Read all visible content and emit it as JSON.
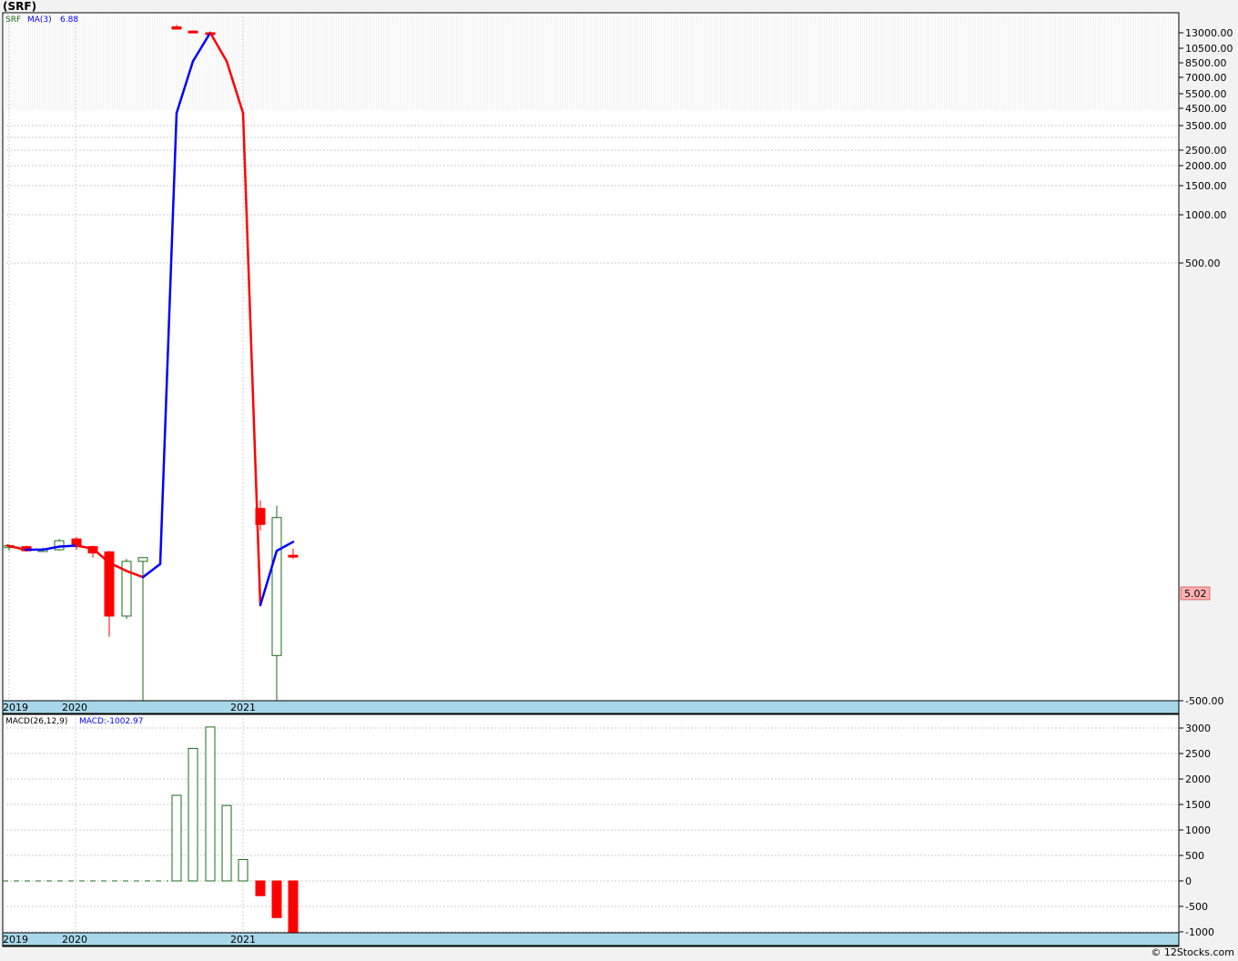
{
  "page_title": "(SRF)",
  "credit": "© 12Stocks.com",
  "colors": {
    "up": "#1a6e1a",
    "down": "#ff0000",
    "ma_up": "#0000ff",
    "ma_down": "#ff0000",
    "year_band": "#a8d8e8",
    "last_price_bg": "#ffb3b3"
  },
  "price_panel": {
    "symbol_label": "SRF",
    "ma_label": "MA(3)",
    "ma_value": "6.88",
    "last_price_label": "5.02",
    "y_ticks": [
      "13000.00",
      "10500.00",
      "8500.00",
      "7000.00",
      "5500.00",
      "4500.00",
      "3500.00",
      "2500.00",
      "2000.00",
      "1500.00",
      "1000.00",
      "500.00",
      "-500.00"
    ],
    "year_labels": [
      "2019",
      "2020",
      "2021"
    ]
  },
  "macd_panel": {
    "label": "MACD(26,12,9)",
    "value_label": "MACD:-1002.97",
    "y_ticks": [
      "3000",
      "2500",
      "2000",
      "1500",
      "1000",
      "500",
      "0",
      "-500",
      "-1000"
    ],
    "year_labels": [
      "2019",
      "2020",
      "2021"
    ]
  },
  "chart_data": [
    {
      "type": "candlestick",
      "title": "(SRF)",
      "scale": "log",
      "x_labels": [
        "2019",
        "2020",
        "2021"
      ],
      "candles": [
        {
          "o": 6.3,
          "h": 6.6,
          "l": 6.0,
          "c": 6.5
        },
        {
          "o": 6.4,
          "h": 6.5,
          "l": 5.9,
          "c": 6.0
        },
        {
          "o": 6.1,
          "h": 6.3,
          "l": 5.9,
          "c": 6.1
        },
        {
          "o": 6.1,
          "h": 7.2,
          "l": 6.0,
          "c": 7.0
        },
        {
          "o": 7.2,
          "h": 7.4,
          "l": 6.1,
          "c": 6.4
        },
        {
          "o": 6.4,
          "h": 6.5,
          "l": 5.4,
          "c": 5.8
        },
        {
          "o": 5.9,
          "h": 6.0,
          "l": 1.6,
          "c": 2.2
        },
        {
          "o": 2.2,
          "h": 5.3,
          "l": 2.1,
          "c": 5.1
        },
        {
          "o": 5.1,
          "h": 5.4,
          "l": 0.6,
          "c": 5.4
        },
        {
          "o": 14500,
          "h": 15000,
          "l": 13800,
          "c": 13900
        },
        {
          "o": 13400,
          "h": 13500,
          "l": 13000,
          "c": 13100
        },
        {
          "o": 13000,
          "h": 13000,
          "l": 12800,
          "c": 12900
        },
        {
          "o": 11.5,
          "h": 13.0,
          "l": 8.2,
          "c": 9.0
        },
        {
          "o": 1.2,
          "h": 12.0,
          "l": 0.6,
          "c": 10.0
        },
        {
          "o": 5.6,
          "h": 6.2,
          "l": 5.3,
          "c": 5.5
        }
      ],
      "ma3": [
        6.5,
        6.1,
        6.2,
        6.5,
        6.6,
        6.2,
        4.8,
        4.3,
        5.4,
        4200,
        8700,
        13000,
        8700,
        4200,
        2.6,
        6.0,
        6.88
      ],
      "ma3_x": [
        0,
        1,
        2,
        3,
        4,
        5,
        6,
        7,
        8,
        9,
        10,
        11,
        12,
        13,
        14,
        15,
        16
      ]
    },
    {
      "type": "bar",
      "title": "MACD(26,12,9)",
      "values": [
        0,
        0,
        0,
        0,
        0,
        0,
        0,
        0,
        0,
        1680,
        2600,
        3020,
        1480,
        420,
        -290,
        -720,
        -1003
      ],
      "ylim": [
        -1000,
        3000
      ]
    }
  ]
}
